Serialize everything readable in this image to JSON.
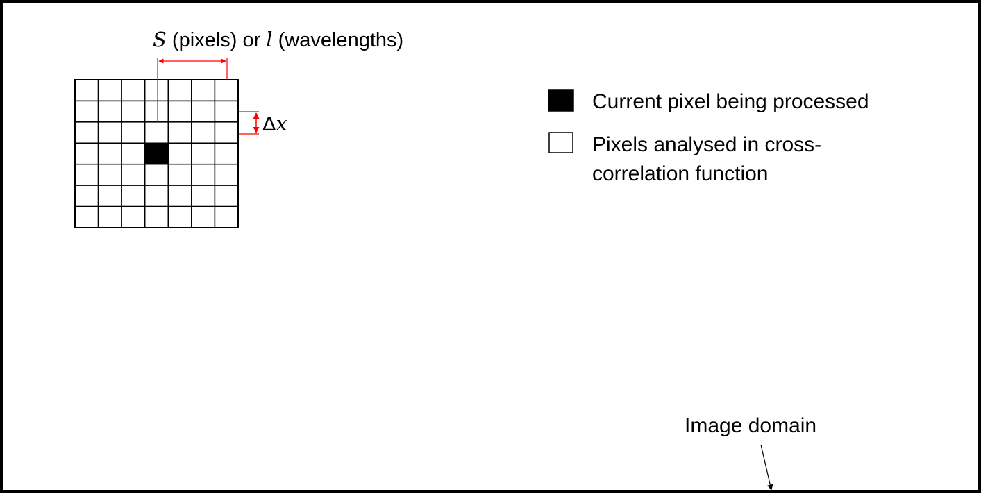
{
  "colors": {
    "border": "#000000",
    "grid": "#000000",
    "dimension": "#ff0000",
    "current_pixel": "#000000",
    "analysed_pixel": "#ffffff"
  },
  "grid": {
    "rows": 7,
    "cols": 7,
    "current_pixel": {
      "row": 3,
      "col": 3
    }
  },
  "annotations": {
    "window_size": {
      "symbol_s": "S",
      "text_pixels": " (pixels) or ",
      "symbol_l": "l",
      "text_wavelengths": " (wavelengths)"
    },
    "pixel_spacing": {
      "delta": "Δ",
      "symbol_x": "x"
    },
    "image_domain": "Image domain"
  },
  "legend": {
    "items": [
      {
        "label_lines": [
          "Current pixel being processed"
        ],
        "swatch": "filled"
      },
      {
        "label_lines": [
          "Pixels analysed in cross-",
          "correlation function"
        ],
        "swatch": "outline"
      }
    ]
  }
}
